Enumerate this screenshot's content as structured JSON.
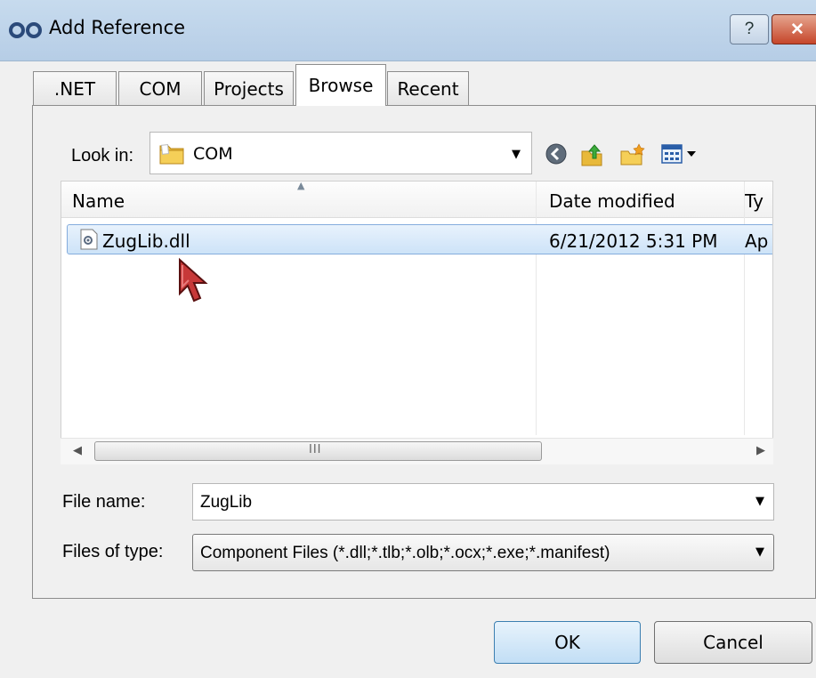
{
  "window": {
    "title": "Add Reference",
    "help_label": "?",
    "close_label": "✕"
  },
  "tabs": [
    {
      "label": ".NET"
    },
    {
      "label": "COM"
    },
    {
      "label": "Projects"
    },
    {
      "label": "Browse",
      "active": true
    },
    {
      "label": "Recent"
    }
  ],
  "look_in": {
    "label": "Look in:",
    "value": "COM"
  },
  "file_list": {
    "columns": [
      "Name",
      "Date modified",
      "Ty"
    ],
    "rows": [
      {
        "name": "ZugLib.dll",
        "date": "6/21/2012 5:31 PM",
        "type": "Ap"
      }
    ],
    "scroll_grip": "III"
  },
  "file_name": {
    "label": "File name:",
    "value": "ZugLib"
  },
  "file_type": {
    "label": "Files of type:",
    "value": "Component Files (*.dll;*.tlb;*.olb;*.ocx;*.exe;*.manifest)"
  },
  "buttons": {
    "ok": "OK",
    "cancel": "Cancel"
  },
  "icons": [
    "references-icon",
    "folder-icon",
    "back-icon",
    "up-folder-icon",
    "new-folder-icon",
    "views-icon",
    "dll-file-icon",
    "mouse-cursor-icon"
  ],
  "colors": {
    "titlebar": "#c2d7ec",
    "selection": "#cde3f8",
    "selection_border": "#84acdd",
    "close_button": "#c6452a"
  }
}
